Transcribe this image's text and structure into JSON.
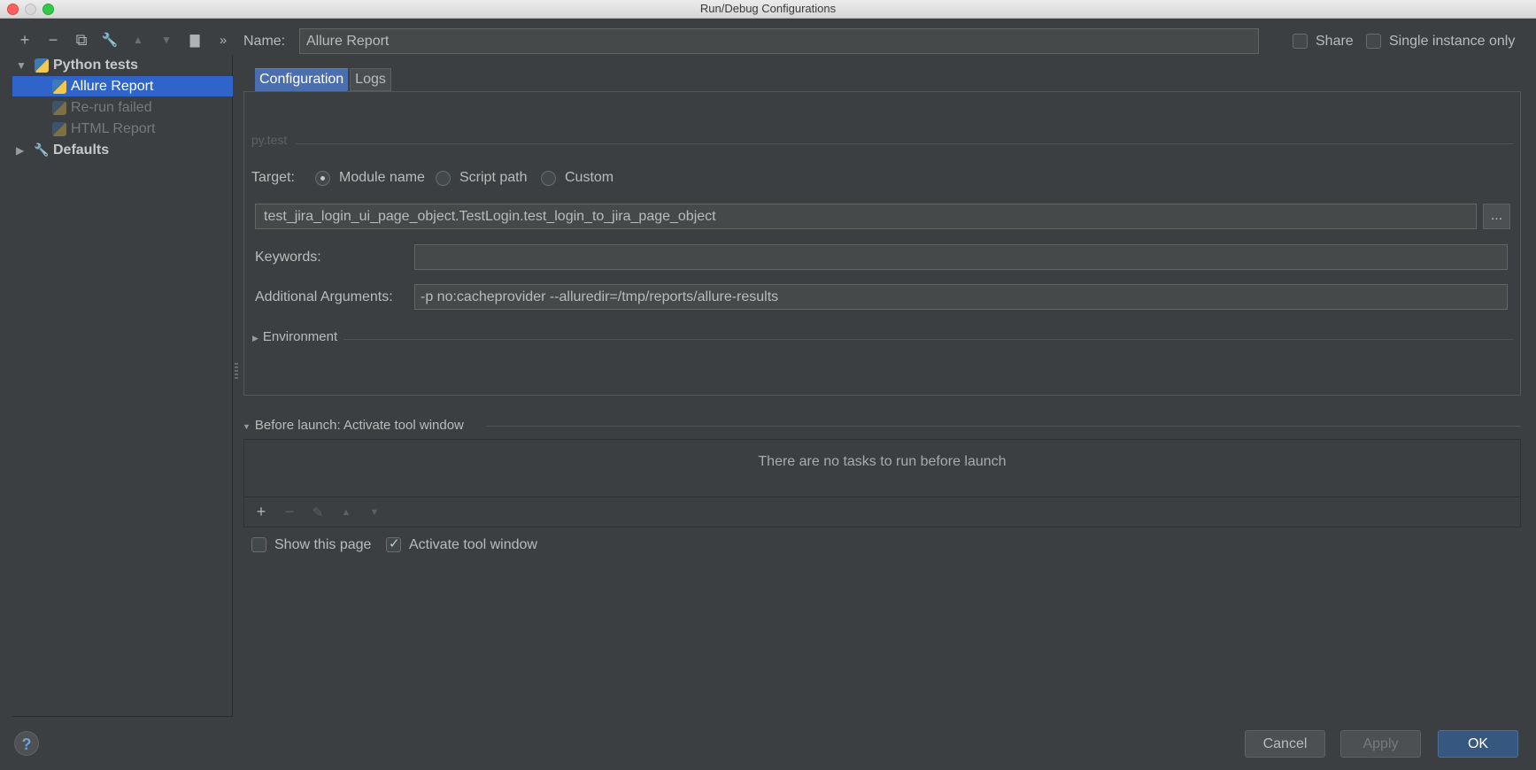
{
  "window": {
    "title": "Run/Debug Configurations"
  },
  "toolbar": {
    "add": "+",
    "remove": "−",
    "copy": "⧉",
    "wrench": "🔧",
    "up": "▲",
    "down": "▼",
    "folder": "▇",
    "more": "»"
  },
  "tree": {
    "root": "Python tests",
    "items": [
      "Allure Report",
      "Re-run failed",
      "HTML Report"
    ],
    "defaults": "Defaults"
  },
  "name": {
    "label": "Name:",
    "value": "Allure Report"
  },
  "share": {
    "label": "Share",
    "checked": false
  },
  "single_instance": {
    "label": "Single instance only",
    "checked": false
  },
  "tabs": [
    "Configuration",
    "Logs"
  ],
  "config": {
    "section": "py.test",
    "target_label": "Target:",
    "target_options": [
      "Module name",
      "Script path",
      "Custom"
    ],
    "target_selected": "Module name",
    "module_value": "test_jira_login_ui_page_object.TestLogin.test_login_to_jira_page_object",
    "browse": "...",
    "keywords_label": "Keywords:",
    "keywords_value": "",
    "args_label": "Additional Arguments:",
    "args_value": "-p no:cacheprovider --alluredir=/tmp/reports/allure-results",
    "environment": "Environment"
  },
  "before_launch": {
    "title": "Before launch: Activate tool window",
    "empty": "There are no tasks to run before launch",
    "tools": {
      "add": "+",
      "remove": "−",
      "edit": "✎",
      "up": "▲",
      "down": "▼"
    }
  },
  "options": {
    "show_page": {
      "label": "Show this page",
      "checked": false
    },
    "activate_tool": {
      "label": "Activate tool window",
      "checked": true
    }
  },
  "buttons": {
    "help": "?",
    "cancel": "Cancel",
    "apply": "Apply",
    "ok": "OK"
  }
}
